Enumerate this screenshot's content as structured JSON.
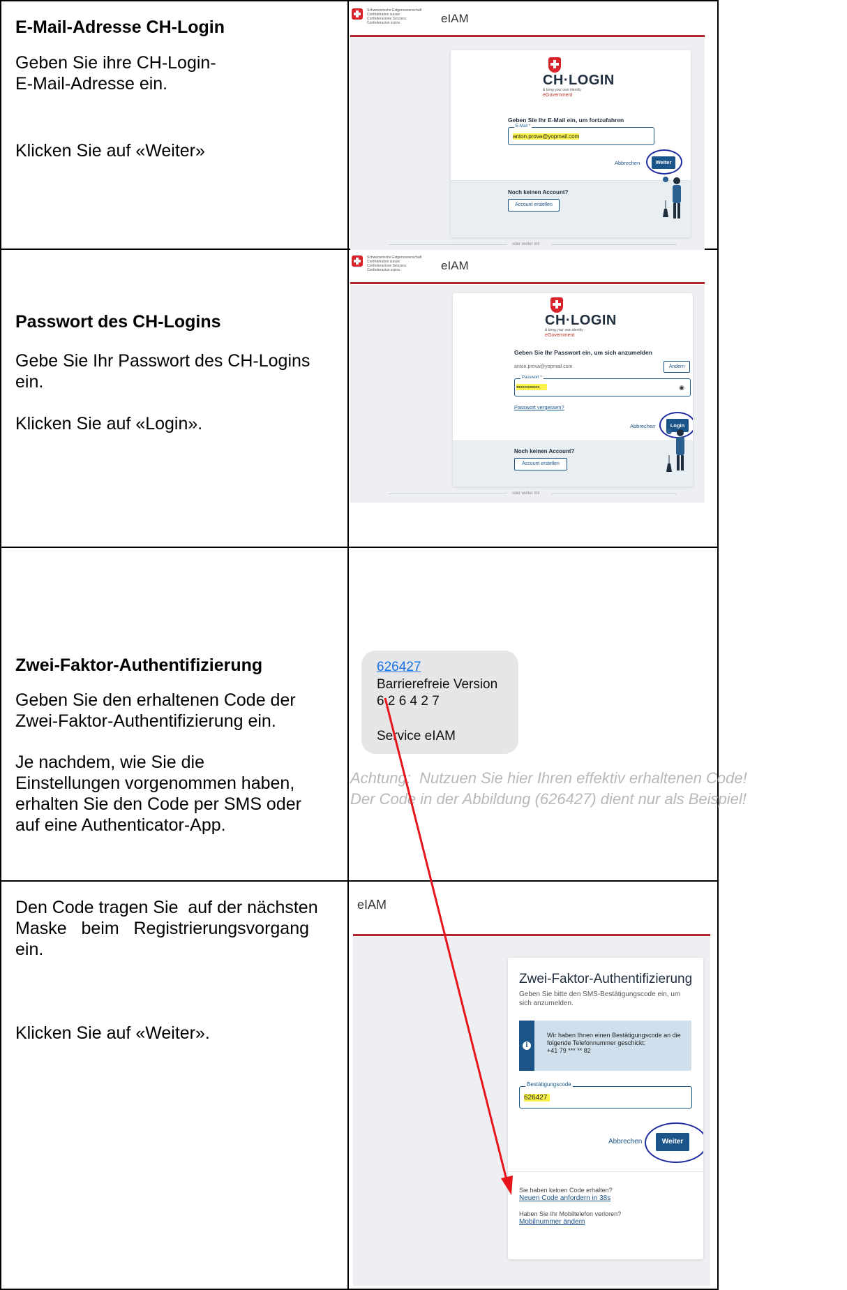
{
  "rows": [
    {
      "heading": "E-Mail-Adresse CH-Login",
      "instruction_line1": "Geben Sie ihre CH-Login-",
      "instruction_line2": "E-Mail-Adresse ein.",
      "action": "Klicken Sie auf «Weiter»"
    },
    {
      "heading": "Passwort des CH-Logins",
      "instruction_line1": "Gebe Sie Ihr Passwort des CH-Logins",
      "instruction_line2": "ein.",
      "action": "Klicken Sie auf «Login»."
    },
    {
      "heading": "Zwei-Faktor-Authentifizierung",
      "instruction_line1": "Geben Sie den erhaltenen Code der",
      "instruction_line2": "Zwei-Faktor-Authentifizierung ein.",
      "para_lines": [
        "Je nachdem, wie Sie die",
        "Einstellungen vorgenommen haben,",
        "erhalten Sie den Code per SMS oder",
        "auf eine Authenticator-App."
      ]
    },
    {
      "para_lines": [
        "Den Code tragen Sie  auf der nächsten",
        "Maske   beim   Registrierungsvorgang",
        "ein."
      ],
      "action": "Klicken Sie auf «Weiter»."
    }
  ],
  "common": {
    "header_app": "eIAM",
    "federal_lines": [
      "Schweizerische Eidgenossenschaft",
      "Confédération suisse",
      "Confederazione Svizzera",
      "Confederaziun svizra"
    ],
    "brand_word": "CH·LOGIN",
    "brand_tagline": "& bring your own identity",
    "brand_egov": "eGovernment",
    "no_account": "Noch keinen Account?",
    "create_account": "Account erstellen",
    "or_continue": "oder weiter mit",
    "cancel": "Abbrechen"
  },
  "screen_email": {
    "title": "Geben Sie Ihr E-Mail ein, um fortzufahren",
    "field_label": "E-Mail *",
    "field_value": "anton.prova@yopmail.com",
    "submit": "Weiter"
  },
  "screen_password": {
    "title": "Geben Sie Ihr Passwort ein, um sich anzumelden",
    "email": "anton.prova@yopmail.com",
    "change": "Ändern",
    "field_label": "Passwort *",
    "field_value": "••••••••••••",
    "forgot": "Passwort vergessen?",
    "submit": "Login"
  },
  "sms": {
    "code_link": "626427",
    "accessible": "Barrierefreie Version",
    "spaced_code": "6 2 6 4 2 7",
    "sender": "Service eIAM"
  },
  "note": {
    "line1": "Achtung:  Nutzuen Sie hier Ihren effektiv erhaltenen Code!",
    "line2": "Der Code in der Abbildung (626427) dient nur als Beispiel!"
  },
  "screen_2fa": {
    "title": "Zwei-Faktor-Authentifizierung",
    "subtitle": "Geben Sie bitte den SMS-Bestätigungscode ein, um sich anzumelden.",
    "info_line1": "Wir haben Ihnen einen Bestätigungscode an die",
    "info_line2": "folgende Telefonnummer geschickt:",
    "info_phone": "+41 79 *** ** 82",
    "field_label": "Bestätigungscode",
    "field_value": "626427",
    "submit": "Weiter",
    "no_code": "Sie haben keinen Code erhalten?",
    "new_code": "Neuen Code anfordern in 38s",
    "lost_phone": "Haben Sie Ihr Mobiltelefon verloren?",
    "change_mobile": "Mobilnummer ändern"
  },
  "colors": {
    "swiss_red": "#d8232a",
    "primary_blue": "#1b5488",
    "highlight": "#fbf24a",
    "annotation_circle": "#1e2aa0",
    "arrow_red": "#e8141c"
  }
}
